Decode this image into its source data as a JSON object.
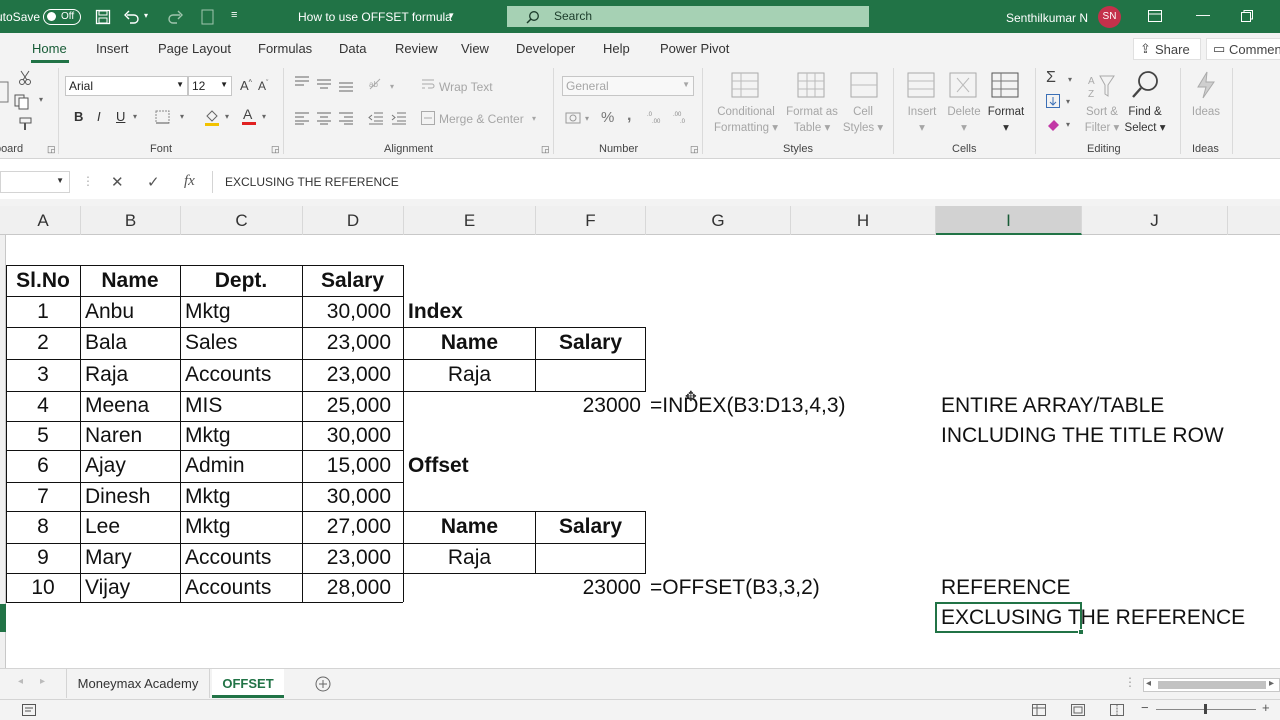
{
  "titlebar": {
    "autosave_label": "AutoSave",
    "autosave_state": "Off",
    "doc_title": "How to use OFFSET formula",
    "search_label": "Search",
    "user_name": "Senthilkumar N",
    "user_initials": "SN",
    "accent": "#217346"
  },
  "tabs": [
    {
      "label": "Home"
    },
    {
      "label": "Insert"
    },
    {
      "label": "Page Layout"
    },
    {
      "label": "Formulas"
    },
    {
      "label": "Data"
    },
    {
      "label": "Review"
    },
    {
      "label": "View"
    },
    {
      "label": "Developer"
    },
    {
      "label": "Help"
    },
    {
      "label": "Power Pivot"
    }
  ],
  "share_label": "Share",
  "comments_label": "Comments",
  "ribbon": {
    "clipboard_group": "Clipboard",
    "font_group": "Font",
    "font_name": "Arial",
    "font_size": "12",
    "bold": "B",
    "italic": "I",
    "underline": "U",
    "alignment_group": "Alignment",
    "wrap_text": "Wrap Text",
    "merge_center": "Merge & Center",
    "number_group": "Number",
    "number_format": "General",
    "styles_group": "Styles",
    "conditional_formatting": [
      "Conditional",
      "Formatting"
    ],
    "format_as_table": [
      "Format as",
      "Table"
    ],
    "cell_styles": [
      "Cell",
      "Styles"
    ],
    "cells_group": "Cells",
    "insert": "Insert",
    "delete": "Delete",
    "format": "Format",
    "editing_group": "Editing",
    "sort_filter": [
      "Sort &",
      "Filter"
    ],
    "find_select": [
      "Find &",
      "Select"
    ],
    "ideas_group": "Ideas",
    "ideas": "Ideas"
  },
  "formula_bar": {
    "fx_label": "fx",
    "content": "EXCLUSING THE REFERENCE"
  },
  "columns": [
    "A",
    "B",
    "C",
    "D",
    "E",
    "F",
    "G",
    "H",
    "I",
    "J"
  ],
  "table": {
    "headers": [
      "Sl.No",
      "Name",
      "Dept.",
      "Salary"
    ],
    "rows": [
      [
        "1",
        "Anbu",
        "Mktg",
        "30,000"
      ],
      [
        "2",
        "Bala",
        "Sales",
        "23,000"
      ],
      [
        "3",
        "Raja",
        "Accounts",
        "23,000"
      ],
      [
        "4",
        "Meena",
        "MIS",
        "25,000"
      ],
      [
        "5",
        "Naren",
        "Mktg",
        "30,000"
      ],
      [
        "6",
        "Ajay",
        "Admin",
        "15,000"
      ],
      [
        "7",
        "Dinesh",
        "Mktg",
        "30,000"
      ],
      [
        "8",
        "Lee",
        "Mktg",
        "27,000"
      ],
      [
        "9",
        "Mary",
        "Accounts",
        "23,000"
      ],
      [
        "10",
        "Vijay",
        "Accounts",
        "28,000"
      ]
    ]
  },
  "index_section": {
    "title": "Index",
    "name_header": "Name",
    "salary_header": "Salary",
    "name_value": "Raja",
    "result": "23000",
    "formula": "=INDEX(B3:D13,4,3)",
    "note_1": "ENTIRE ARRAY/TABLE",
    "note_2": "INCLUDING THE TITLE ROW"
  },
  "offset_section": {
    "title": "Offset",
    "name_header": "Name",
    "salary_header": "Salary",
    "name_value": "Raja",
    "result": "23000",
    "formula": "=OFFSET(B3,3,2)",
    "note_1": "REFERENCE",
    "note_2": "EXCLUSING THE REFERENCE"
  },
  "sheets": [
    {
      "label": "Moneymax Academy"
    },
    {
      "label": "OFFSET"
    }
  ]
}
